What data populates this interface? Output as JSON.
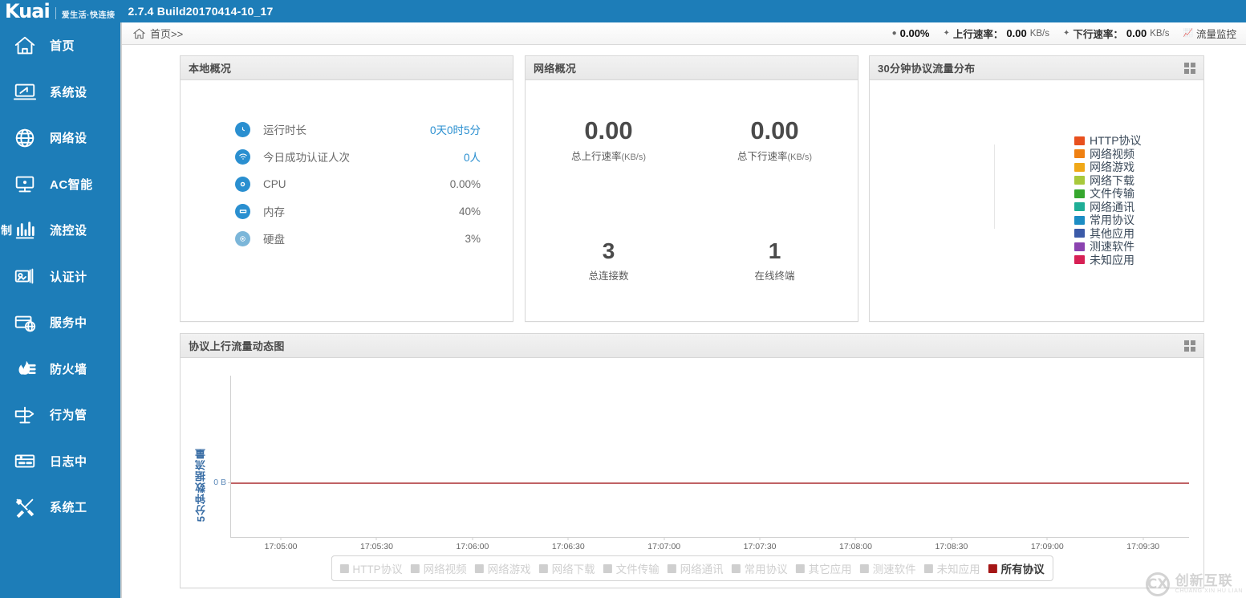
{
  "brand": {
    "logo_text": "Kuai",
    "slogan": "爱生活·快连接",
    "version": "2.7.4 Build20170414-10_17"
  },
  "breadcrumb": {
    "home_icon": "home-icon",
    "text": "首页>>"
  },
  "status": {
    "cpu": {
      "icon": "bullet-icon",
      "value": "0.00%"
    },
    "upload": {
      "icon": "bullet-icon",
      "label": "上行速率：",
      "value": "0.00",
      "unit": "KB/s"
    },
    "download": {
      "icon": "bullet-icon",
      "label": "下行速率：",
      "value": "0.00",
      "unit": "KB/s"
    },
    "monitor": {
      "icon": "monitor-icon",
      "label": "流量监控"
    }
  },
  "sidebar": {
    "ghost_char": "制",
    "items": [
      {
        "icon": "home-icon",
        "label": "首页"
      },
      {
        "icon": "monitor-icon",
        "label": "系统设"
      },
      {
        "icon": "globe-icon",
        "label": "网络设"
      },
      {
        "icon": "ac-device-icon",
        "label": "AC智能"
      },
      {
        "icon": "bar-chart-icon",
        "label": "流控设"
      },
      {
        "icon": "cards-icon",
        "label": "认证计"
      },
      {
        "icon": "service-icon",
        "label": "服务中"
      },
      {
        "icon": "firewall-icon",
        "label": "防火墙"
      },
      {
        "icon": "signpost-icon",
        "label": "行为管"
      },
      {
        "icon": "logbook-icon",
        "label": "日志中"
      },
      {
        "icon": "tools-icon",
        "label": "系统工"
      }
    ]
  },
  "panels": {
    "local": {
      "title": "本地概况",
      "rows": [
        {
          "icon": "clock-icon",
          "name": "运行时长",
          "value": "0天0时5分",
          "accent": true
        },
        {
          "icon": "wifi-icon",
          "name": "今日成功认证人次",
          "value": "0人",
          "accent": true
        },
        {
          "icon": "cpu-icon",
          "name": "CPU",
          "value": "0.00%",
          "accent": false
        },
        {
          "icon": "memory-icon",
          "name": "内存",
          "value": "40%",
          "accent": false
        },
        {
          "icon": "disk-icon",
          "name": "硬盘",
          "value": "3%",
          "accent": false
        }
      ]
    },
    "network": {
      "title": "网络概况",
      "cells": [
        {
          "value": "0.00",
          "label": "总上行速率",
          "unit": "(KB/s)"
        },
        {
          "value": "0.00",
          "label": "总下行速率",
          "unit": "(KB/s)"
        },
        {
          "value": "3",
          "label": "总连接数",
          "unit": ""
        },
        {
          "value": "1",
          "label": "在线终端",
          "unit": ""
        }
      ]
    },
    "protocol_pie": {
      "title": "30分钟协议流量分布",
      "grid_icon": "grid-icon",
      "legend": [
        {
          "label": "HTTP协议",
          "color": "#e8501e"
        },
        {
          "label": "网络视频",
          "color": "#ef8012"
        },
        {
          "label": "网络游戏",
          "color": "#f0a818"
        },
        {
          "label": "网络下载",
          "color": "#a8c93b"
        },
        {
          "label": "文件传输",
          "color": "#36a72e"
        },
        {
          "label": "网络通讯",
          "color": "#1fae96"
        },
        {
          "label": "常用协议",
          "color": "#1c8dc4"
        },
        {
          "label": "其他应用",
          "color": "#3b5aa8"
        },
        {
          "label": "测速软件",
          "color": "#8b43b0"
        },
        {
          "label": "未知应用",
          "color": "#d72055"
        }
      ]
    },
    "chart": {
      "title": "协议上行流量动态图",
      "grid_icon": "grid-icon"
    }
  },
  "chart_data": {
    "type": "line",
    "title": "协议上行流量动态图",
    "xlabel": "",
    "ylabel": "5分钟数据流量",
    "x": [
      "17:05:00",
      "17:05:30",
      "17:06:00",
      "17:06:30",
      "17:07:00",
      "17:07:30",
      "17:08:00",
      "17:08:30",
      "17:09:00",
      "17:09:30"
    ],
    "yticks": [
      "0 B"
    ],
    "ylim": [
      0,
      0
    ],
    "grid": false,
    "legend_position": "bottom",
    "series": [
      {
        "name": "HTTP协议",
        "color": "#cfcfcf",
        "active": false,
        "values": []
      },
      {
        "name": "网络视频",
        "color": "#cfcfcf",
        "active": false,
        "values": []
      },
      {
        "name": "网络游戏",
        "color": "#cfcfcf",
        "active": false,
        "values": []
      },
      {
        "name": "网络下载",
        "color": "#cfcfcf",
        "active": false,
        "values": []
      },
      {
        "name": "文件传输",
        "color": "#cfcfcf",
        "active": false,
        "values": []
      },
      {
        "name": "网络通讯",
        "color": "#cfcfcf",
        "active": false,
        "values": []
      },
      {
        "name": "常用协议",
        "color": "#cfcfcf",
        "active": false,
        "values": []
      },
      {
        "name": "其它应用",
        "color": "#cfcfcf",
        "active": false,
        "values": []
      },
      {
        "name": "测速软件",
        "color": "#cfcfcf",
        "active": false,
        "values": []
      },
      {
        "name": "未知应用",
        "color": "#cfcfcf",
        "active": false,
        "values": []
      },
      {
        "name": "所有协议",
        "color": "#a51616",
        "active": true,
        "values": [
          0,
          0,
          0,
          0,
          0,
          0,
          0,
          0,
          0,
          0
        ]
      }
    ]
  },
  "watermark": {
    "mark": "CX",
    "cn": "创新互联",
    "en": "CHUANG XIN HU LIAN"
  },
  "colors": {
    "brand_blue": "#1d7db8",
    "accent_blue": "#2a8fd0",
    "chart_red": "#a51616",
    "panel_border": "#d7d7d7"
  }
}
